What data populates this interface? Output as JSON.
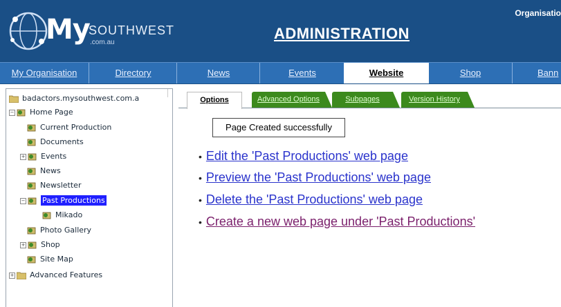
{
  "header": {
    "logo_my": "My",
    "logo_southwest": "SOUTHWEST",
    "logo_domain": ".com.au",
    "title": "ADMINISTRATION",
    "org_link": "Organisatio"
  },
  "nav": {
    "items": [
      {
        "label": "My Organisation"
      },
      {
        "label": "Directory"
      },
      {
        "label": "News"
      },
      {
        "label": "Events"
      },
      {
        "label": "Website"
      },
      {
        "label": "Shop"
      },
      {
        "label": "Bann"
      }
    ],
    "active": "Website"
  },
  "tree": {
    "root": "badactors.mysouthwest.com.a",
    "items": [
      {
        "label": "Home Page",
        "expander": "−"
      },
      {
        "label": "Current Production"
      },
      {
        "label": "Documents"
      },
      {
        "label": "Events",
        "expander": "+"
      },
      {
        "label": "News"
      },
      {
        "label": "Newsletter"
      },
      {
        "label": "Past Productions",
        "expander": "−",
        "selected": true
      },
      {
        "label": "Mikado"
      },
      {
        "label": "Photo Gallery"
      },
      {
        "label": "Shop",
        "expander": "+"
      },
      {
        "label": "Site Map"
      },
      {
        "label": "Advanced Features",
        "expander": "+"
      }
    ]
  },
  "tabs": [
    {
      "label": "Options",
      "active": true
    },
    {
      "label": "Advanced Options"
    },
    {
      "label": "Subpages"
    },
    {
      "label": "Version History"
    }
  ],
  "notice": "Page Created successfully",
  "actions": [
    {
      "label": "Edit the 'Past Productions' web page"
    },
    {
      "label": "Preview the 'Past Productions' web page"
    },
    {
      "label": "Delete the 'Past Productions' web page"
    },
    {
      "label": "Create a new web page under 'Past Productions'"
    }
  ],
  "colors": {
    "header_bg": "#1a4f86",
    "nav_bg": "#2d6fb5",
    "tab_green": "#3c8a1d",
    "link_blue": "#2a33cc",
    "link_visited": "#7a1f6b",
    "selected_bg": "#2020ff"
  }
}
